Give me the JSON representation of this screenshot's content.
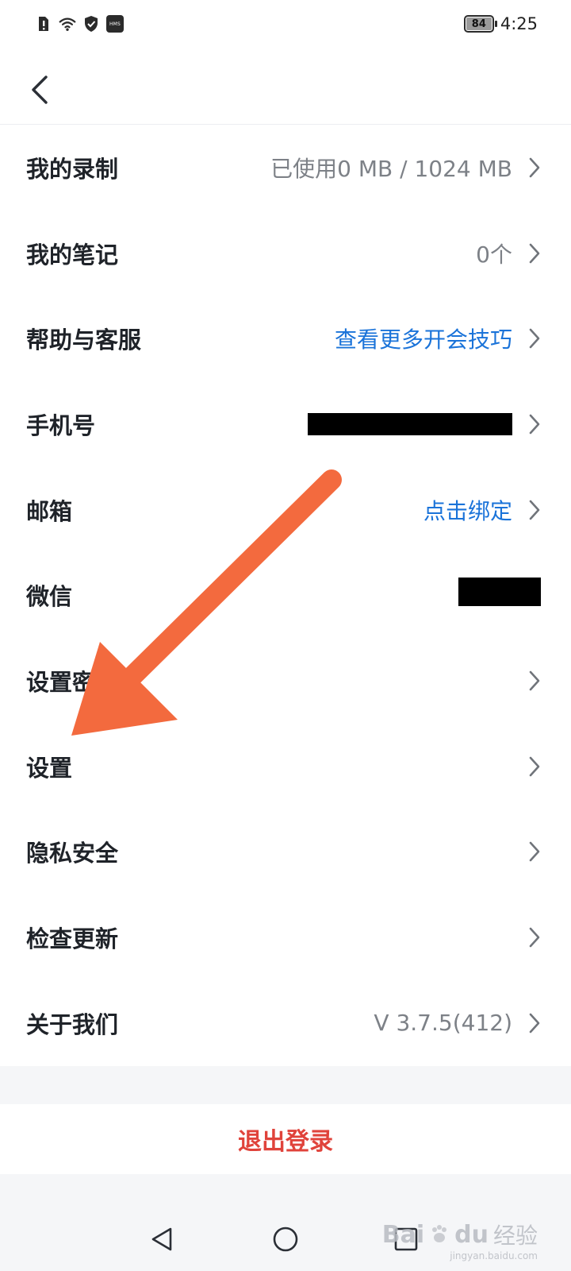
{
  "status_bar": {
    "icons": [
      "alert-sim-icon",
      "wifi-icon",
      "shield-icon",
      "hms-icon"
    ],
    "hms_text": "HMS",
    "battery_level": "84",
    "time": "4:25"
  },
  "header": {
    "back_icon": "chevron-left-icon"
  },
  "menu": {
    "items": [
      {
        "label": "我的录制",
        "value": "已使用0 MB / 1024 MB",
        "value_style": "gray",
        "has_chevron": true
      },
      {
        "label": "我的笔记",
        "value": "0个",
        "value_style": "gray",
        "has_chevron": true
      },
      {
        "label": "帮助与客服",
        "value": "查看更多开会技巧",
        "value_style": "blue",
        "has_chevron": true
      },
      {
        "label": "手机号",
        "value": "",
        "value_style": "redacted",
        "has_chevron": true
      },
      {
        "label": "邮箱",
        "value": "点击绑定",
        "value_style": "blue",
        "has_chevron": true
      },
      {
        "label": "微信",
        "value": "",
        "value_style": "redacted",
        "has_chevron": false
      },
      {
        "label": "设置密码",
        "value": "",
        "value_style": "gray",
        "has_chevron": true
      },
      {
        "label": "设置",
        "value": "",
        "value_style": "gray",
        "has_chevron": true
      },
      {
        "label": "隐私安全",
        "value": "",
        "value_style": "gray",
        "has_chevron": true
      },
      {
        "label": "检查更新",
        "value": "",
        "value_style": "gray",
        "has_chevron": true
      },
      {
        "label": "关于我们",
        "value": "V 3.7.5(412)",
        "value_style": "gray",
        "has_chevron": true
      }
    ]
  },
  "logout": {
    "label": "退出登录"
  },
  "system_nav": {
    "icons": [
      "back-triangle-icon",
      "home-circle-icon",
      "recents-square-icon"
    ]
  },
  "annotation": {
    "arrow_color": "#f36a3e"
  },
  "watermark": {
    "logo_text": "Bai",
    "logo_text_2": "du",
    "logo_cn": "经验",
    "url": "jingyan.baidu.com"
  },
  "colors": {
    "accent_blue": "#1a73d9",
    "danger_red": "#e0433b",
    "text_primary": "#1f2329",
    "text_secondary": "#7d8187"
  }
}
